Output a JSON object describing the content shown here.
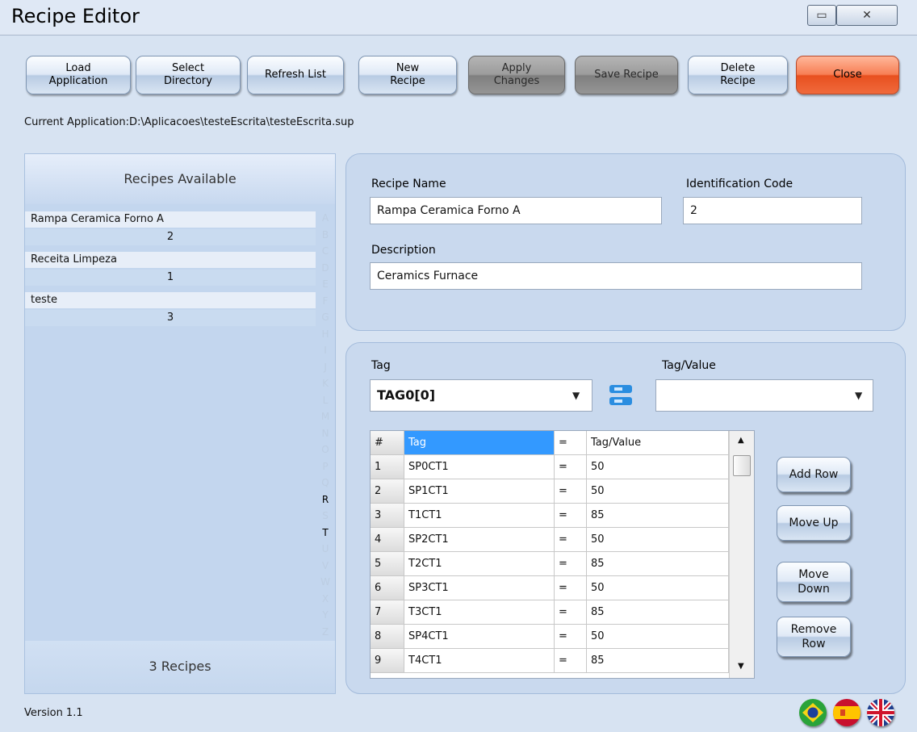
{
  "window": {
    "title": "Recipe Editor",
    "minimize_glyph": "▭",
    "close_glyph": "✕"
  },
  "toolbar": {
    "load_application": "Load\nApplication",
    "select_directory": "Select\nDirectory",
    "refresh_list": "Refresh List",
    "new_recipe": "New\nRecipe",
    "apply_changes": "Apply\nChanges",
    "save_recipe": "Save Recipe",
    "delete_recipe": "Delete\nRecipe",
    "close": "Close"
  },
  "current_application": "Current Application:D:\\Aplicacoes\\testeEscrita\\testeEscrita.sup",
  "recipes_panel": {
    "header": "Recipes  Available",
    "items": [
      {
        "name": "Rampa Ceramica Forno A",
        "code": "2"
      },
      {
        "name": "Receita Limpeza",
        "code": "1"
      },
      {
        "name": "teste",
        "code": "3"
      }
    ],
    "letters": [
      "A",
      "B",
      "C",
      "D",
      "E",
      "F",
      "G",
      "H",
      "I",
      "J",
      "K",
      "L",
      "M",
      "N",
      "O",
      "P",
      "Q",
      "R",
      "S",
      "T",
      "U",
      "V",
      "W",
      "X",
      "Y",
      "Z"
    ],
    "active_letters": [
      "R",
      "T"
    ],
    "footer": "3 Recipes"
  },
  "recipe_form": {
    "name_label": "Recipe Name",
    "name_value": "Rampa Ceramica Forno A",
    "id_label": "Identification Code",
    "id_value": "2",
    "desc_label": "Description",
    "desc_value": "Ceramics Furnace"
  },
  "tag_section": {
    "tag_label": "Tag",
    "tag_value": "TAG0[0]",
    "tagvalue_label": "Tag/Value",
    "tagvalue_value": ""
  },
  "grid": {
    "headers": [
      "#",
      "Tag",
      "=",
      "Tag/Value"
    ],
    "rows": [
      [
        "1",
        "SP0CT1",
        "=",
        "50"
      ],
      [
        "2",
        "SP1CT1",
        "=",
        "50"
      ],
      [
        "3",
        "T1CT1",
        "=",
        "85"
      ],
      [
        "4",
        "SP2CT1",
        "=",
        "50"
      ],
      [
        "5",
        "T2CT1",
        "=",
        "85"
      ],
      [
        "6",
        "SP3CT1",
        "=",
        "50"
      ],
      [
        "7",
        "T3CT1",
        "=",
        "85"
      ],
      [
        "8",
        "SP4CT1",
        "=",
        "50"
      ],
      [
        "9",
        "T4CT1",
        "=",
        "85"
      ]
    ]
  },
  "side_buttons": {
    "add_row": "Add Row",
    "move_up": "Move Up",
    "move_down": "Move\nDown",
    "remove_row": "Remove\nRow"
  },
  "version": "Version  1.1",
  "colors": {
    "accent": "#3399ff",
    "close_button": "#f06a3c",
    "disabled_button": "#9c9c9c"
  }
}
